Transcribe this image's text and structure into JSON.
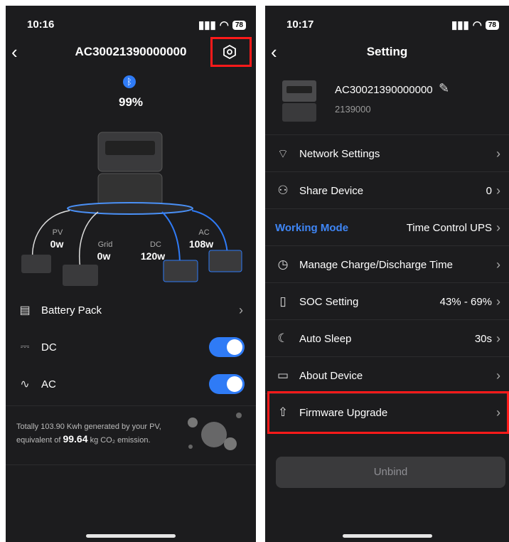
{
  "left": {
    "status": {
      "time": "10:16",
      "battery": "78"
    },
    "title": "AC30021390000000",
    "battery_percent": "99%",
    "flows": [
      {
        "label": "PV",
        "value": "0w"
      },
      {
        "label": "Grid",
        "value": "0w"
      },
      {
        "label": "DC",
        "value": "120w"
      },
      {
        "label": "AC",
        "value": "108w"
      }
    ],
    "rows": {
      "battery_pack": "Battery Pack",
      "dc": "DC",
      "ac": "AC"
    },
    "toggles": {
      "dc": true,
      "ac": true
    },
    "footer": {
      "line1": "Totally 103.90 Kwh generated by your PV,",
      "pre": "equivalent of",
      "value": "99.64",
      "post": "kg CO₂ emission."
    }
  },
  "right": {
    "status": {
      "time": "10:17",
      "battery": "78"
    },
    "title": "Setting",
    "device": {
      "name": "AC30021390000000",
      "id": "2139000"
    },
    "items": [
      {
        "label": "Network Settings",
        "value": "",
        "icon": "antenna-icon"
      },
      {
        "label": "Share Device",
        "value": "0",
        "icon": "user-add-icon"
      },
      {
        "label": "Working Mode",
        "value": "Time Control UPS",
        "icon": ""
      },
      {
        "label": "Manage Charge/Discharge Time",
        "value": "",
        "icon": "clock-icon"
      },
      {
        "label": "SOC Setting",
        "value": "43% - 69%",
        "icon": "battery-icon"
      },
      {
        "label": "Auto Sleep",
        "value": "30s",
        "icon": "sleep-icon"
      },
      {
        "label": "About Device",
        "value": "",
        "icon": "device-icon"
      },
      {
        "label": "Firmware Upgrade",
        "value": "",
        "icon": "upload-icon"
      }
    ],
    "unbind": "Unbind"
  },
  "colors": {
    "accent": "#2f7bf6",
    "highlight": "#ff1a1a",
    "bg": "#1c1c1e"
  }
}
